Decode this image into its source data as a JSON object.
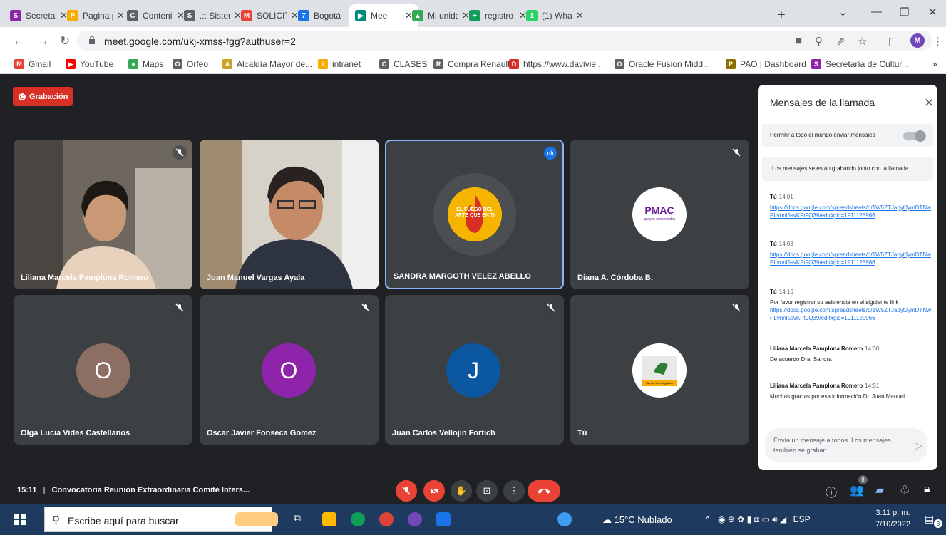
{
  "browser": {
    "tabs": [
      {
        "label": "Secretar",
        "color": "#8e24aa",
        "glyph": "S"
      },
      {
        "label": "Pagina p",
        "color": "#f9ab00",
        "glyph": "P"
      },
      {
        "label": "Contenic",
        "color": "#5f6368",
        "glyph": "C"
      },
      {
        "label": ".:: Sistem",
        "color": "#5f6368",
        "glyph": "S"
      },
      {
        "label": "SOLICIT",
        "color": "#ea4335",
        "glyph": "M"
      },
      {
        "label": "Bogotá",
        "color": "#1a73e8",
        "glyph": "7"
      },
      {
        "label": "Mee",
        "color": "#00897b",
        "glyph": "▶"
      },
      {
        "label": "Mi unida",
        "color": "#34a853",
        "glyph": "▲"
      },
      {
        "label": "registro",
        "color": "#0f9d58",
        "glyph": "+"
      },
      {
        "label": "(1) What",
        "color": "#25d366",
        "glyph": "1"
      }
    ],
    "url": "meet.google.com/ukj-xmss-fgg?authuser=2",
    "profile_initial": "M",
    "bookmarks": [
      {
        "label": "Gmail",
        "color": "#ea4335",
        "glyph": "M"
      },
      {
        "label": "YouTube",
        "color": "#ff0000",
        "glyph": "▶"
      },
      {
        "label": "Maps",
        "color": "#34a853",
        "glyph": "●"
      },
      {
        "label": "Orfeo",
        "color": "#5f6368",
        "glyph": "O"
      },
      {
        "label": "Alcaldía Mayor de...",
        "color": "#c9a227",
        "glyph": "A"
      },
      {
        "label": "intranet",
        "color": "#f9ab00",
        "glyph": "i"
      },
      {
        "label": "CLASES",
        "color": "#5f6368",
        "glyph": "C"
      },
      {
        "label": "Compra Renault",
        "color": "#5f6368",
        "glyph": "R"
      },
      {
        "label": "https://www.davivie...",
        "color": "#d93025",
        "glyph": "D"
      },
      {
        "label": "Oracle Fusion Midd...",
        "color": "#5f6368",
        "glyph": "O"
      },
      {
        "label": "PAO | Dashboard",
        "color": "#8d6e00",
        "glyph": "P"
      },
      {
        "label": "Secretaría de Cultur...",
        "color": "#8e24aa",
        "glyph": "S"
      }
    ],
    "more_bookmarks": "»"
  },
  "meet": {
    "recording_label": "Grabación",
    "tiles": [
      {
        "name": "Liliana Marcela Pamplona Romero",
        "kind": "video"
      },
      {
        "name": "Juan Manuel Vargas Ayala",
        "kind": "video"
      },
      {
        "name": "SANDRA MARGOTH VELEZ ABELLO",
        "kind": "logo"
      },
      {
        "name": "Diana A. Córdoba B.",
        "kind": "logo"
      },
      {
        "name": "Olga Lucia Vides Castellanos",
        "kind": "initial",
        "initial": "O",
        "color": "#8d6e63"
      },
      {
        "name": "Oscar Javier Fonseca Gomez",
        "kind": "initial",
        "initial": "O",
        "color": "#8e24aa"
      },
      {
        "name": "Juan Carlos Vellojin Fortich",
        "kind": "initial",
        "initial": "J",
        "color": "#0b57a0"
      },
      {
        "name": "Tú",
        "kind": "logo"
      }
    ],
    "logo_text": {
      "sandra": "EL FUEGO DEL ARTE QUE EN TI",
      "diana": "PMAC",
      "diana_sub": "apoyos concertados",
      "tu": "Caribe Investigativo"
    },
    "chat": {
      "title": "Mensajes de la llamada",
      "allow_label": "Permitir a todo el mundo enviar mensajes",
      "recording_note": "Los mensajes se están grabando junto con la llamada",
      "messages": [
        {
          "author": "Tú",
          "time": "14:01",
          "text": "",
          "link": "https://docs.google.com/spreadsheets/d/1W5ZTJapytJymDTNwPLvnnl5svKPt9Q39/edit#gid=1911125966"
        },
        {
          "author": "Tú",
          "time": "14:03",
          "text": "",
          "link": "https://docs.google.com/spreadsheets/d/1W5ZTJapytJymDTNwPLvnnl5svKPt9Q39/edit#gid=1911125966"
        },
        {
          "author": "Tú",
          "time": "14:16",
          "text": "Por favor registrar su asistencia en el siguiente link",
          "link": "https://docs.google.com/spreadsheets/d/1W5ZTJapytJymDTNwPLvnnl5svKPt9Q39/edit#gid=1911125966"
        },
        {
          "author": "Liliana Marcela Pamplona Romero",
          "time": "14:30",
          "text": "De acuerdo Dra. Sandra",
          "link": ""
        },
        {
          "author": "Liliana Marcela Pamplona Romero",
          "time": "14:51",
          "text": "Muchas gracias por esa información Dr. Juan Manuel",
          "link": ""
        }
      ],
      "input_placeholder": "Envía un mensaje a todos. Los mensajes también se graban."
    },
    "meeting_time": "15:11",
    "meeting_title": "Convocatoria Reunión Extraordinaria Comité Inters...",
    "participant_count": "8"
  },
  "taskbar": {
    "search_placeholder": "Escribe aquí para buscar",
    "weather": "15°C  Nublado",
    "language": "ESP",
    "time": "3:11 p. m.",
    "date": "7/10/2022",
    "notifications": "3"
  },
  "colors": {
    "accent": "#1a73e8",
    "danger": "#ea4335",
    "meet_bg": "#202124",
    "tile_bg": "#3c4043"
  }
}
